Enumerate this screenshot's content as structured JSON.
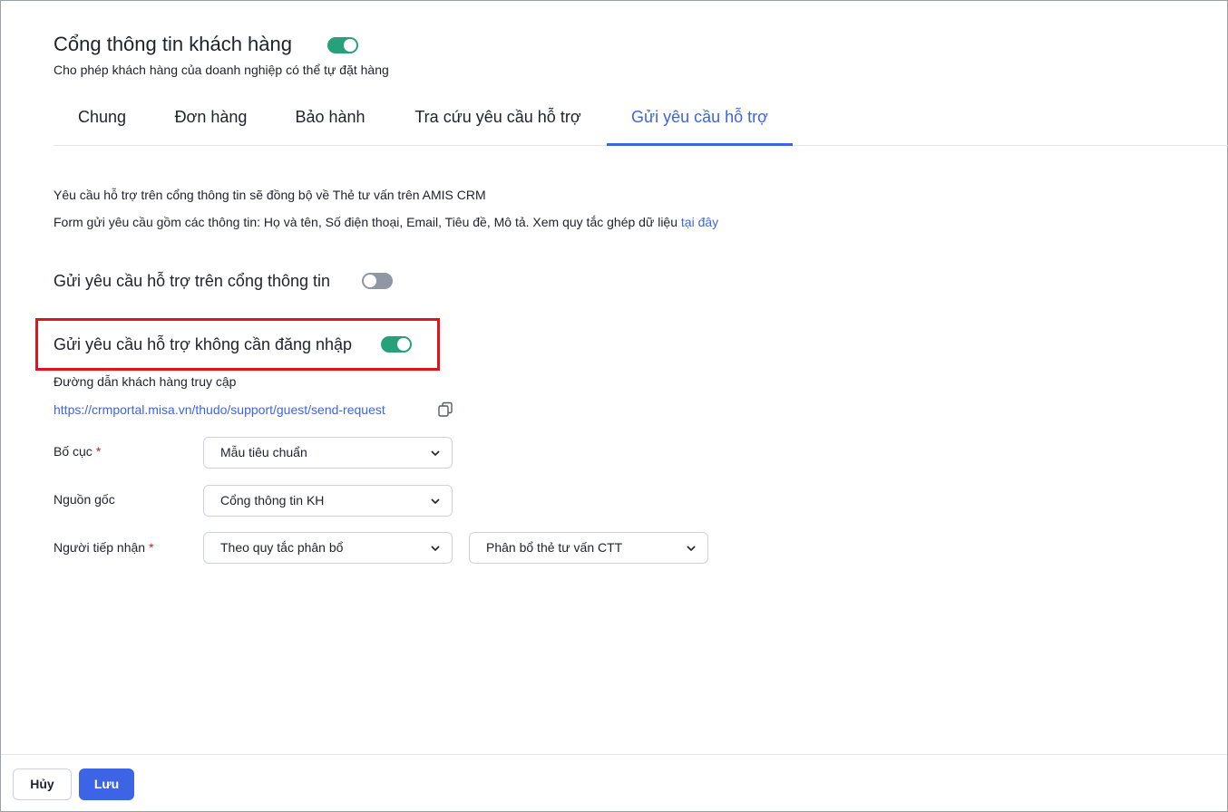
{
  "header": {
    "title": "Cổng thông tin khách hàng",
    "portal_toggle": "on",
    "subtitle": "Cho phép khách hàng của doanh nghiệp có thể tự đặt hàng"
  },
  "tabs": [
    {
      "label": "Chung",
      "active": false
    },
    {
      "label": "Đơn hàng",
      "active": false
    },
    {
      "label": "Bảo hành",
      "active": false
    },
    {
      "label": "Tra cứu yêu cầu hỗ trợ",
      "active": false
    },
    {
      "label": "Gửi yêu cầu hỗ trợ",
      "active": true
    }
  ],
  "info": {
    "line1": "Yêu cầu hỗ trợ trên cổng thông tin sẽ đồng bộ về Thẻ tư vấn trên AMIS CRM",
    "line2": "Form gửi yêu cầu gồm các thông tin: Họ và tên, Số điện thoại, Email, Tiêu đề, Mô tả. Xem quy tắc ghép dữ liệu ",
    "line2_link": "tại đây"
  },
  "settings": {
    "portal_request_label": "Gửi yêu cầu hỗ trợ trên cổng thông tin",
    "portal_request_toggle": "off",
    "guest_request_label": "Gửi yêu cầu hỗ trợ không cần đăng nhập",
    "guest_request_toggle": "on",
    "access_link_label": "Đường dẫn khách hàng truy cập",
    "access_url": "https://crmportal.misa.vn/thudo/support/guest/send-request"
  },
  "form": {
    "layout_label": "Bố cục",
    "layout_value": "Mẫu tiêu chuẩn",
    "source_label": "Nguồn gốc",
    "source_value": "Cổng thông tin KH",
    "receiver_label": "Người tiếp nhận",
    "receiver_value": "Theo quy tắc phân bổ",
    "assign_rule_value": "Phân bổ thẻ tư vấn CTT",
    "required_mark": "*"
  },
  "footer": {
    "cancel_label": "Hủy",
    "save_label": "Lưu"
  },
  "colors": {
    "accent": "#3e64e6",
    "toggle_on": "#27a17a",
    "toggle_off": "#9096a3",
    "highlight": "#e0141a"
  }
}
